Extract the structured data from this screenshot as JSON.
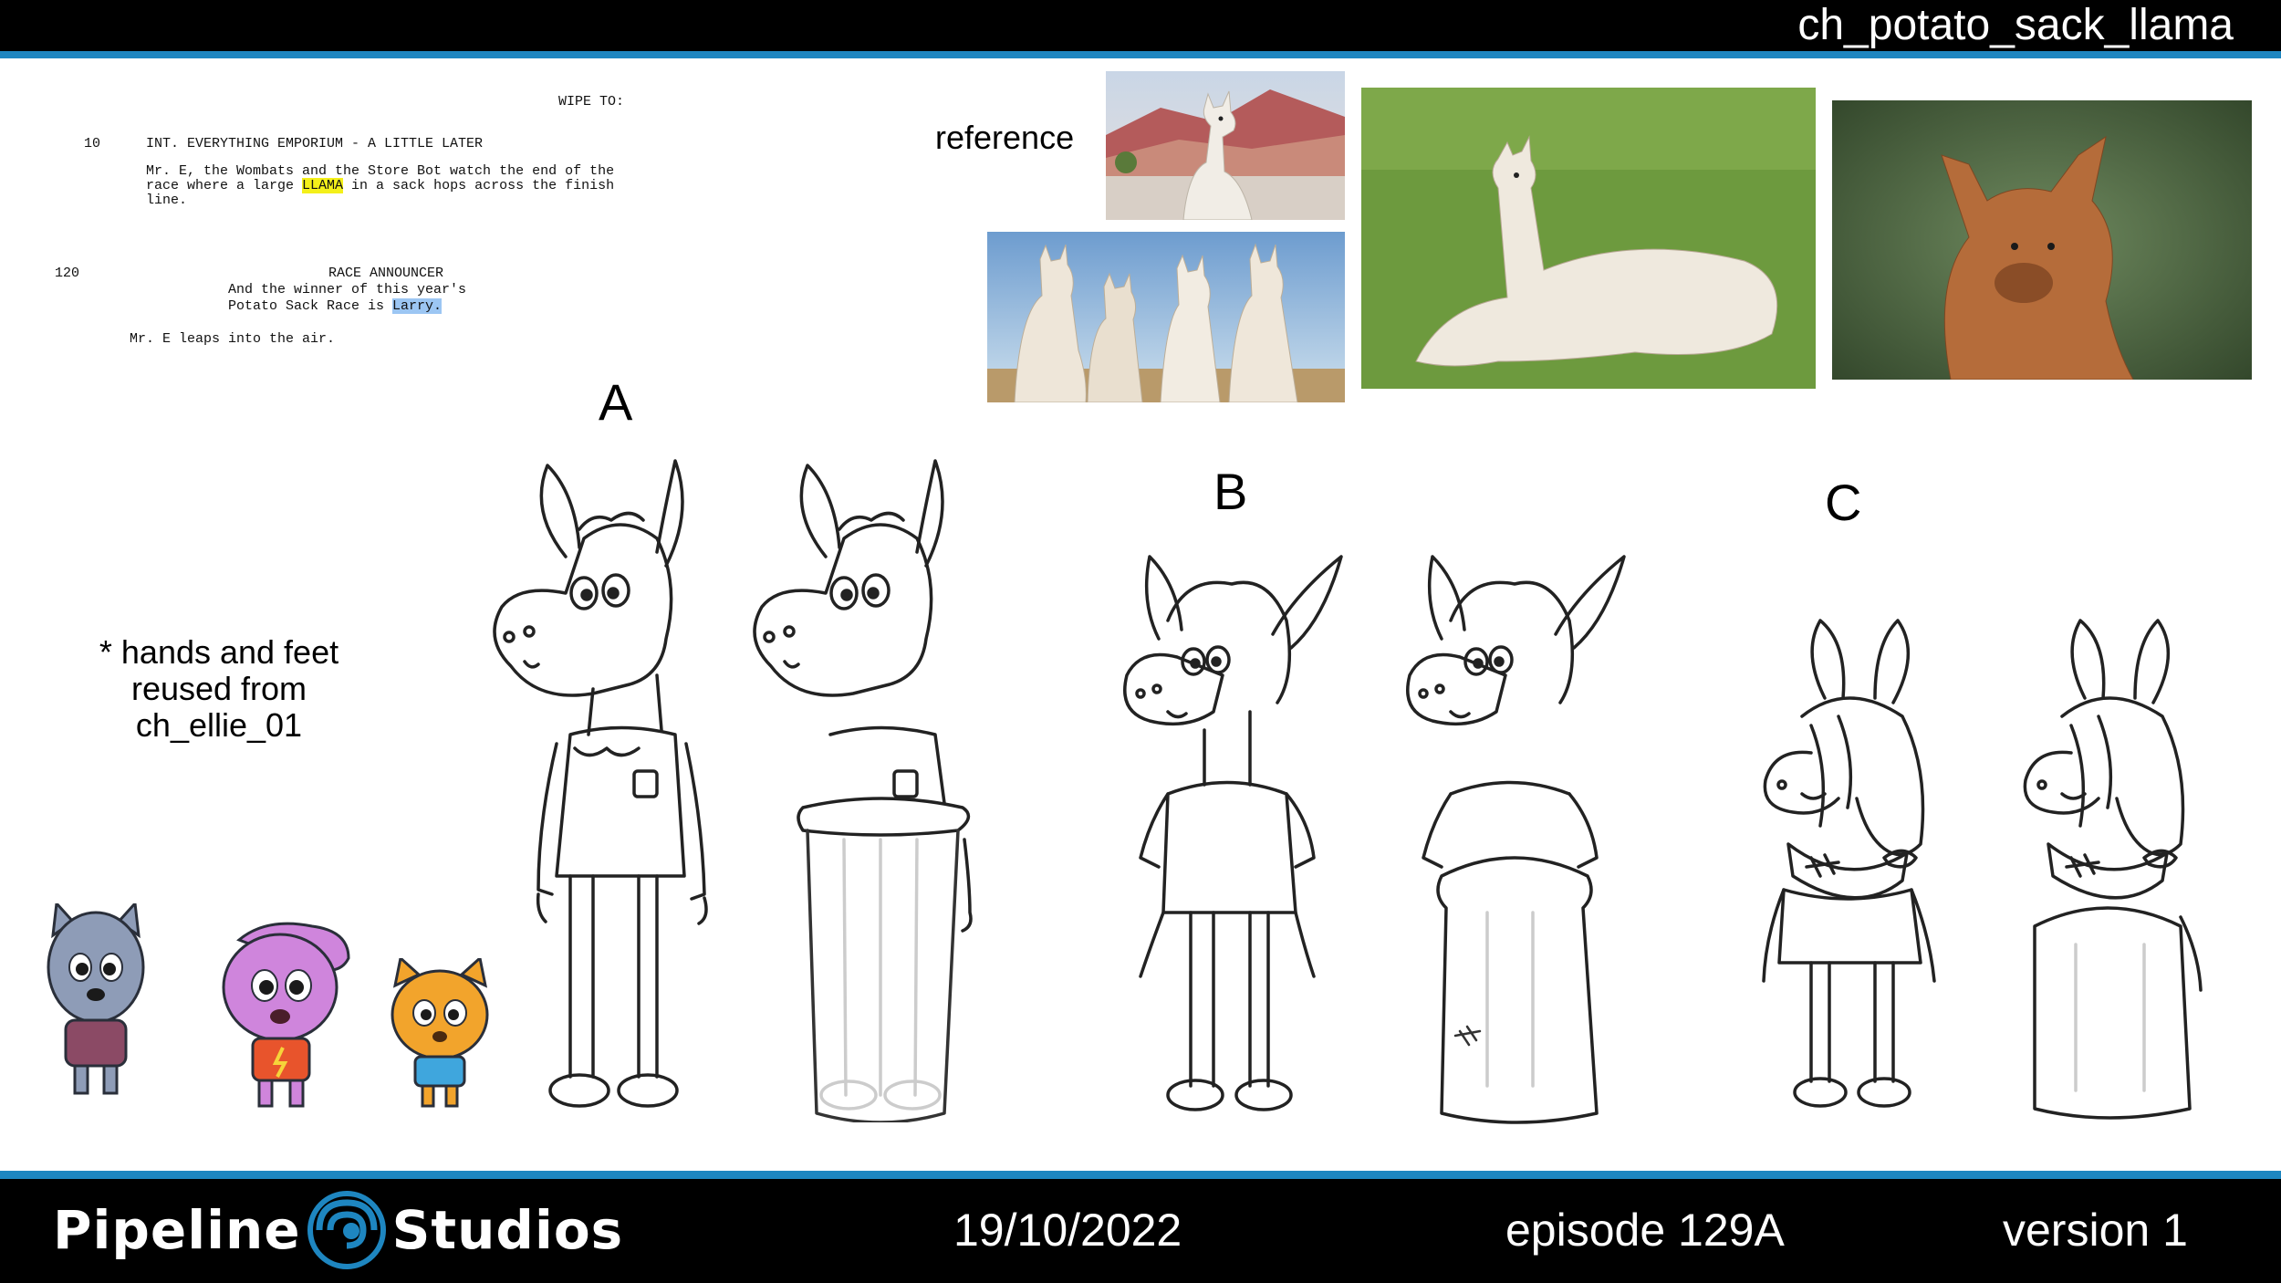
{
  "header": {
    "title": "ch_potato_sack_llama"
  },
  "script": {
    "wipe": "WIPE TO:",
    "scene_number": "10",
    "scene_heading": "INT. EVERYTHING EMPORIUM - A LITTLE LATER",
    "action1_line1": "Mr. E, the Wombats and the Store Bot watch the end of the",
    "action1_line2_a": "race where a large ",
    "action1_line2_hl": "LLAMA",
    "action1_line2_b": " in a sack hops across the finish",
    "action1_line3": "line.",
    "line_number": "120",
    "character": "RACE ANNOUNCER",
    "dialogue_line1": "And the winner of this year's",
    "dialogue_line2_a": "Potato Sack Race is ",
    "dialogue_line2_hl": "Larry.",
    "action2": "Mr. E leaps into the air."
  },
  "reference": {
    "label": "reference"
  },
  "variants": {
    "a": "A",
    "b": "B",
    "c": "C"
  },
  "note": {
    "line1": "* hands and feet",
    "line2": "reused from",
    "line3": "ch_ellie_01"
  },
  "footer": {
    "logo_left": "Pipeline",
    "logo_right": "Studios",
    "date": "19/10/2022",
    "episode": "episode 129A",
    "version": "version 1"
  },
  "colors": {
    "accent": "#1e86c0",
    "bar": "#000000",
    "highlight_yellow": "#f4f01a",
    "highlight_blue": "#9cc6f3"
  }
}
